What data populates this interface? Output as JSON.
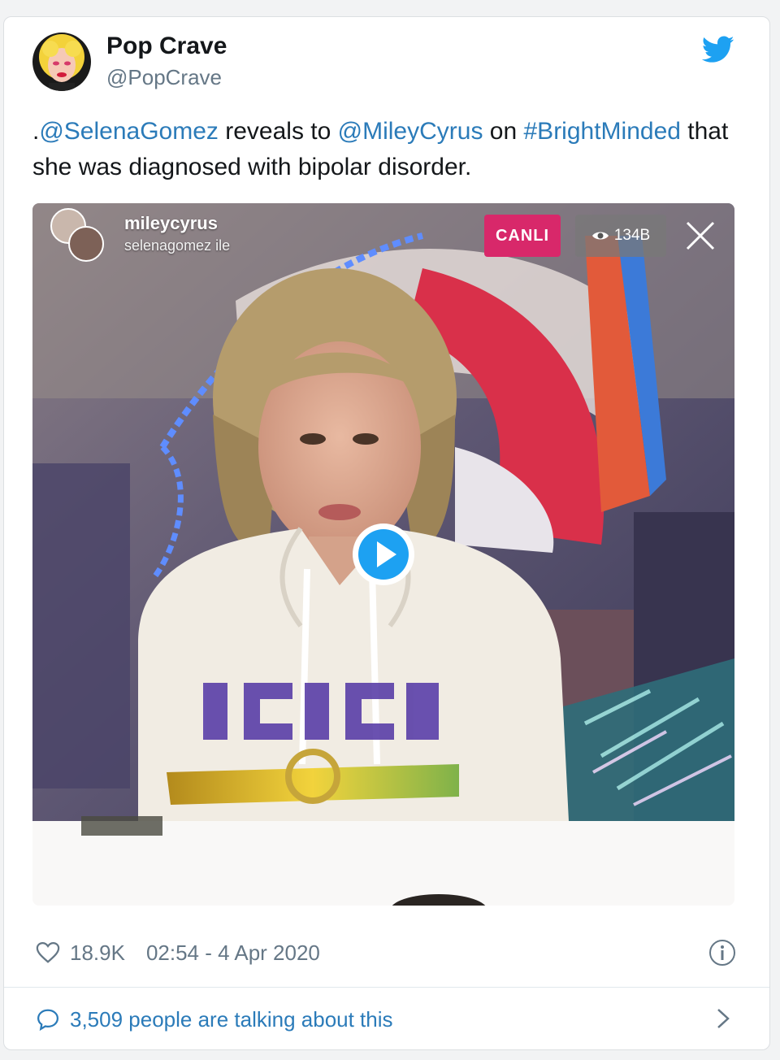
{
  "tweet": {
    "author_name": "Pop Crave",
    "author_handle": "@PopCrave",
    "text_prefix": ".",
    "mention_1": "@SelenaGomez",
    "text_2": " reveals to ",
    "mention_2": "@MileyCyrus",
    "text_3": " on ",
    "hashtag": "#BrightMinded",
    "text_4": " that she was diagnosed with bipolar disorder.",
    "likes": "18.9K",
    "timestamp": "02:54 - 4 Apr 2020",
    "talking": "3,509 people are talking about this"
  },
  "video_overlay": {
    "username": "mileycyrus",
    "subtitle": "selenagomez ile",
    "live_label": "CANLI",
    "viewer_count": "134B"
  },
  "icons": {
    "brand": "twitter-bird-icon",
    "like": "heart-icon",
    "info": "info-icon",
    "reply": "speech-bubble-icon",
    "more": "chevron-right-icon",
    "play": "play-icon",
    "close": "close-icon",
    "viewers": "eye-icon"
  },
  "colors": {
    "link": "#2b7bb9",
    "twitter_blue": "#1da1f2",
    "live_badge": "#d8286a",
    "secondary_text": "#657786"
  }
}
